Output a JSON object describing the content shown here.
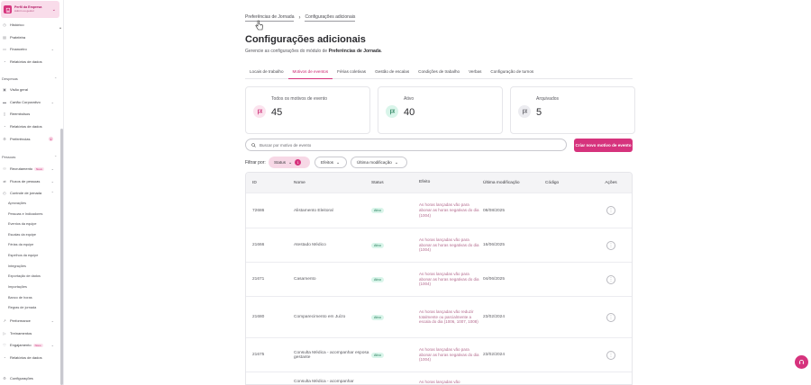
{
  "profile": {
    "title": "Perfil da Empresa",
    "subtitle": "Admin ou gestor"
  },
  "sidebar": {
    "top_items": [
      {
        "label": "Histórico",
        "icon": "history-icon"
      },
      {
        "label": "Prateleira",
        "icon": "shelf-icon"
      },
      {
        "label": "Financeiro",
        "icon": "wallet-icon"
      },
      {
        "label": "Relatórios de dados",
        "icon": "report-icon"
      }
    ],
    "section_despesas": "Despesas",
    "despesas_items": [
      {
        "label": "Visão geral"
      },
      {
        "label": "Cartão Corporativo"
      },
      {
        "label": "Reembolsos"
      },
      {
        "label": "Relatórios de dados"
      },
      {
        "label": "Preferências",
        "count": "3"
      }
    ],
    "section_pessoas": "Pessoas",
    "pessoas_items": [
      {
        "label": "Recrutamento",
        "badge": "Novo"
      },
      {
        "label": "Fluxos de pessoas"
      },
      {
        "label": "Controle de jornada"
      }
    ],
    "jornada_subitems": [
      "Aprovações",
      "Pessoas e Indicadores",
      "Eventos da equipe",
      "Escalas da equipe",
      "Férias da equipe",
      "Espelhos da equipe",
      "Integrações",
      "Exportação de dados",
      "Importações",
      "Banco de horas",
      "Regras de jornada"
    ],
    "bottom_items": [
      {
        "label": "Performance"
      },
      {
        "label": "Treinamentos"
      },
      {
        "label": "Engajamento",
        "badge": "Novo"
      },
      {
        "label": "Relatórios de dados"
      },
      {
        "label": "Configurações"
      }
    ]
  },
  "breadcrumb": {
    "first": "Preferências de Jornada",
    "second": "Configurações adicionais"
  },
  "page": {
    "title": "Configurações adicionais",
    "subtitle_prefix": "Gerencie as configurações do módulo de ",
    "subtitle_bold": "Preferências de Jornada",
    "subtitle_suffix": "."
  },
  "tabs": [
    "Locais de trabalho",
    "Motivos de eventos",
    "Férias coletivas",
    "Gestão de escalas",
    "Condições de trabalho",
    "Verbas",
    "Configuração de turnos"
  ],
  "cards": [
    {
      "label": "Todos os motivos de evento",
      "value": "45"
    },
    {
      "label": "Ativo",
      "value": "40"
    },
    {
      "label": "Arquivados",
      "value": "5"
    }
  ],
  "search": {
    "placeholder": "Buscar por motivo de evento"
  },
  "create_button": "Criar novo motivo de evento",
  "filters": {
    "label": "Filtrar por:",
    "status": "Status",
    "status_count": "1",
    "efeitos": "Efeitos",
    "ultima": "Última modificação"
  },
  "table": {
    "headers": {
      "id": "ID",
      "nome": "Nome",
      "status": "Status",
      "efeito": "Efeito",
      "data": "Última modificação",
      "codigo": "Código",
      "acoes": "Ações"
    },
    "rows": [
      {
        "id": "72686",
        "nome": "Alistamento Eleitoral",
        "status": "Ativo",
        "efeito": "As horas lançadas vão para abonar as horas negativas do dia (1004)",
        "data": "08/08/2025",
        "codigo": ""
      },
      {
        "id": "21666",
        "nome": "Atestado Médico",
        "status": "Ativo",
        "efeito": "As horas lançadas vão para abonar as horas negativas do dia (1004)",
        "data": "16/06/2025",
        "codigo": ""
      },
      {
        "id": "21671",
        "nome": "Casamento",
        "status": "Ativo",
        "efeito": "As horas lançadas vão para abonar as horas negativas do dia (1004)",
        "data": "04/06/2025",
        "codigo": ""
      },
      {
        "id": "21680",
        "nome": "Comparecimento em Juízo",
        "status": "Ativo",
        "efeito": "As horas lançadas vão reduzir totalmente ou parcialmente a escala do dia (1006, 1007, 1008)",
        "data": "23/02/2024",
        "codigo": ""
      },
      {
        "id": "21675",
        "nome": "Consulta Médica - acompanhar esposa gestante",
        "status": "Ativo",
        "efeito": "As horas lançadas vão para abonar as horas negativas do dia (1004)",
        "data": "23/02/2024",
        "codigo": ""
      },
      {
        "id": "",
        "nome": "Consulta Médica - acompanhar",
        "status": "",
        "efeito": "As horas lançadas vão",
        "data": "",
        "codigo": ""
      }
    ]
  },
  "colors": {
    "accent": "#d6337d",
    "accent_light": "#f7d8e6",
    "success_bg": "#d9f5ea",
    "success_text": "#1f7a55"
  }
}
